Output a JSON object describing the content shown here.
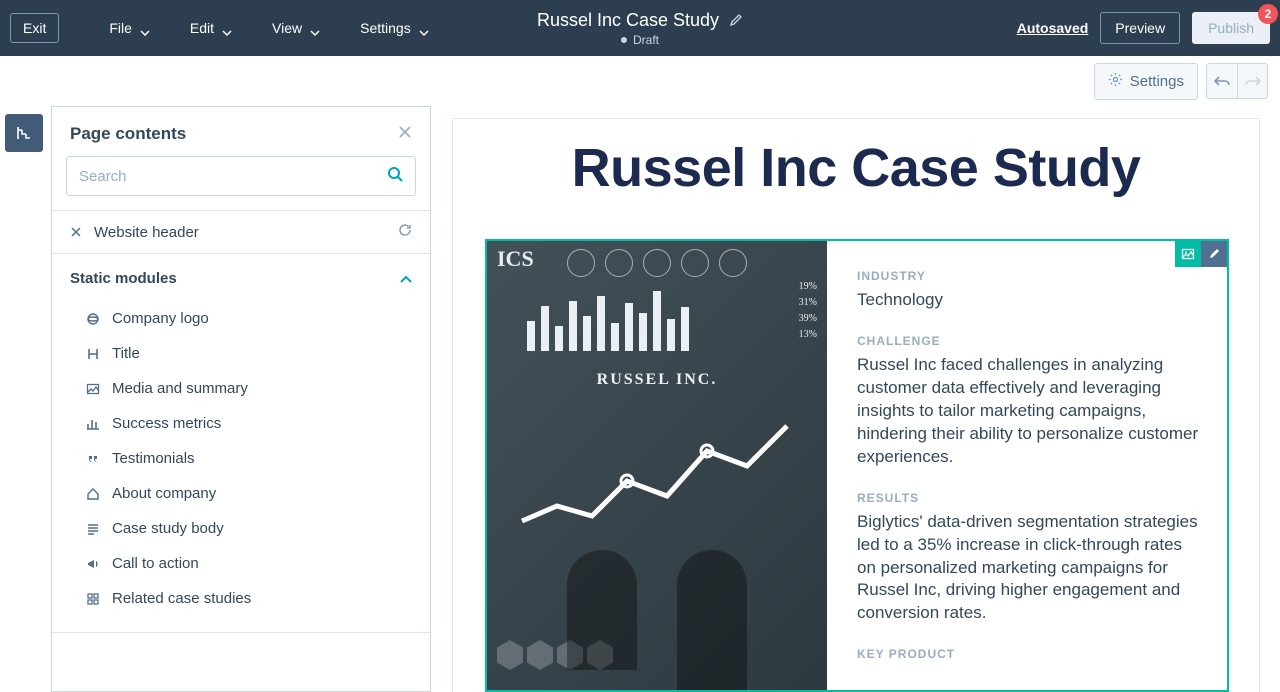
{
  "topbar": {
    "exit": "Exit",
    "menus": [
      "File",
      "Edit",
      "View",
      "Settings"
    ],
    "title": "Russel Inc Case Study",
    "status": "Draft",
    "autosaved": "Autosaved",
    "preview": "Preview",
    "publish": "Publish",
    "badge": "2"
  },
  "toolbar": {
    "settings": "Settings"
  },
  "panel": {
    "title": "Page contents",
    "search_placeholder": "Search",
    "header_module": "Website header",
    "section": "Static modules",
    "modules": [
      "Company logo",
      "Title",
      "Media and summary",
      "Success metrics",
      "Testimonials",
      "About company",
      "Case study body",
      "Call to action",
      "Related case studies"
    ]
  },
  "page": {
    "h1": "Russel Inc Case Study",
    "hero_brand": "RUSSEL INC.",
    "summary": {
      "industry_label": "INDUSTRY",
      "industry": "Technology",
      "challenge_label": "CHALLENGE",
      "challenge": "Russel Inc faced challenges in analyzing customer data effectively and leveraging insights to tailor marketing campaigns, hindering their ability to personalize customer experiences.",
      "results_label": "RESULTS",
      "results": "Biglytics' data-driven segmentation strategies led to a 35% increase in click-through rates on personalized marketing campaigns for Russel Inc, driving higher engagement and conversion rates.",
      "key_product_label": "KEY PRODUCT"
    }
  }
}
